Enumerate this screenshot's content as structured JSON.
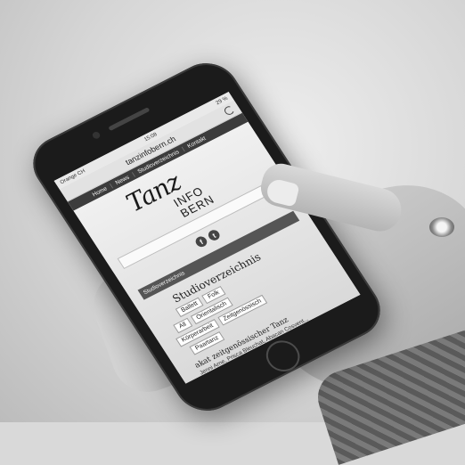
{
  "phone": {
    "status": {
      "carrier": "Orange CH",
      "time": "15:08",
      "battery": "29 %"
    },
    "url": "tanzinfobern.ch",
    "nav": {
      "items": [
        "Home",
        "News",
        "Studioverzeichnis",
        "Kontakt"
      ]
    },
    "logo": {
      "script": "Tanz",
      "line1": "INFO",
      "line2": "BERN"
    },
    "socials": {
      "facebook": "f",
      "twitter": "t"
    },
    "dropdown_value": "Studioverzeichnis",
    "section_title": "Studioverzeichnis",
    "chips": {
      "row1": [
        "Ballett",
        "Folk"
      ],
      "row2": [
        "All",
        "Orientalisch"
      ],
      "row3": [
        "Körperarbeit",
        "Zeitgenössisch"
      ],
      "row4": [
        "Paartanz"
      ]
    },
    "footer": {
      "title": "akat zeitgenössischer Tanz",
      "subtitle": "Jenni Arne, Prisca Bleuchat, Abacan Cosvent..."
    }
  },
  "colors": {
    "navbar": "#3c3c3c",
    "dropdown": "#555555",
    "phone_body": "#1b1b1b"
  }
}
